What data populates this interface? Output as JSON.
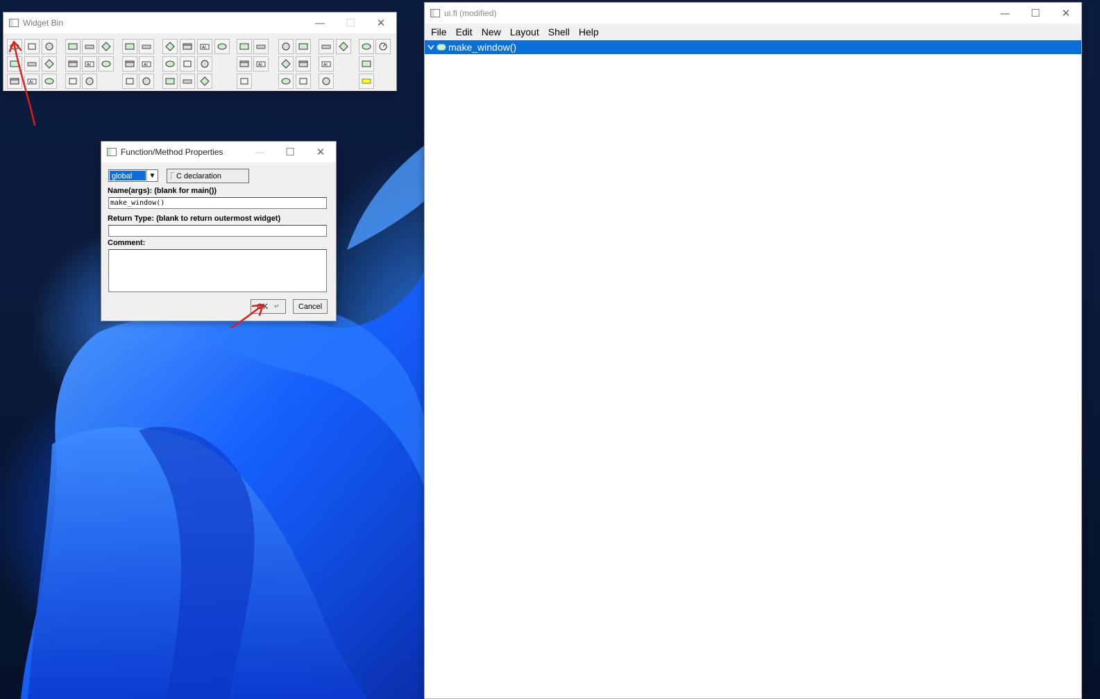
{
  "widget_bin": {
    "title": "Widget Bin",
    "controls": {
      "minimize": "—",
      "maximize": "☐",
      "close": "✕"
    }
  },
  "function_dialog": {
    "title": "Function/Method Properties",
    "controls": {
      "minimize": "—",
      "maximize": "☐",
      "close": "✕"
    },
    "scope_value": "global",
    "c_declaration_label": "C declaration",
    "name_label": "Name(args): (blank for main())",
    "name_value": "make_window()",
    "return_type_label": "Return Type: (blank to return outermost widget)",
    "return_type_value": "",
    "comment_label": "Comment:",
    "comment_value": "",
    "ok_label": "OK",
    "cancel_label": "Cancel"
  },
  "main_window": {
    "title": "ui.fl (modified)",
    "controls": {
      "minimize": "—",
      "maximize": "☐",
      "close": "✕"
    },
    "menu": [
      "File",
      "Edit",
      "New",
      "Layout",
      "Shell",
      "Help"
    ],
    "tree_items": [
      {
        "label": "make_window()",
        "selected": true
      }
    ]
  },
  "annotation_color": "#e01e1e"
}
